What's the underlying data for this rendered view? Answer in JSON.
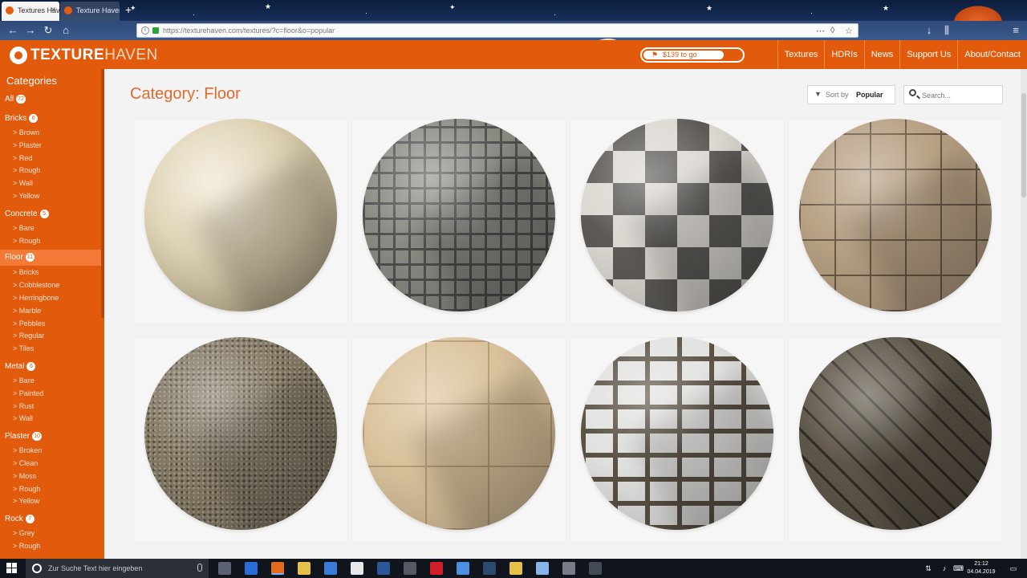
{
  "browser": {
    "tabs": [
      {
        "label": "Textures Haven",
        "active": true
      },
      {
        "label": "Texture Haven",
        "active": false
      }
    ],
    "new_tab_icon": "+",
    "url": "https://texturehaven.com/textures/?c=floor&o=popular",
    "nav_icons": [
      "back-icon",
      "forward-icon",
      "reload-icon",
      "home-icon"
    ]
  },
  "site": {
    "logo_bold": "TEXTURE",
    "logo_light": "HAVEN",
    "patreon": {
      "label": "$139 to go",
      "progress": 0.82
    },
    "nav": [
      "Textures",
      "HDRIs",
      "News",
      "Support Us",
      "About/Contact"
    ],
    "brand_color": "#e25a0b"
  },
  "sidebar": {
    "title": "Categories",
    "categories": [
      {
        "name": "All",
        "count": "72",
        "subs": []
      },
      {
        "name": "Bricks",
        "count": "6",
        "subs": [
          "Brown",
          "Plaster",
          "Red",
          "Rough",
          "Wall",
          "Yellow"
        ]
      },
      {
        "name": "Concrete",
        "count": "5",
        "subs": [
          "Bare",
          "Rough"
        ]
      },
      {
        "name": "Floor",
        "count": "11",
        "selected": true,
        "subs": [
          "Bricks",
          "Cobblestone",
          "Herringbone",
          "Marble",
          "Pebbles",
          "Regular",
          "Tiles"
        ]
      },
      {
        "name": "Metal",
        "count": "6",
        "subs": [
          "Bare",
          "Painted",
          "Rust",
          "Wall"
        ]
      },
      {
        "name": "Plaster",
        "count": "10",
        "subs": [
          "Broken",
          "Clean",
          "Moss",
          "Rough",
          "Yellow"
        ]
      },
      {
        "name": "Rock",
        "count": "7",
        "subs": [
          "Grey",
          "Rough"
        ]
      }
    ]
  },
  "main": {
    "title": "Category: Floor",
    "sort": {
      "label": "Sort by",
      "value": "Popular"
    },
    "search": {
      "placeholder": "Search..."
    },
    "textures": [
      {
        "material": "beige-tiles"
      },
      {
        "material": "dark-small-tiles"
      },
      {
        "material": "checker-marble"
      },
      {
        "material": "tan-tiles"
      },
      {
        "material": "gravel"
      },
      {
        "material": "sandstone-tiles"
      },
      {
        "material": "white-cobblestone"
      },
      {
        "material": "herringbone-bricks"
      }
    ]
  },
  "taskbar": {
    "search_placeholder": "Zur Suche Text hier eingeben",
    "time": "21:12",
    "date": "04.04.2019"
  }
}
